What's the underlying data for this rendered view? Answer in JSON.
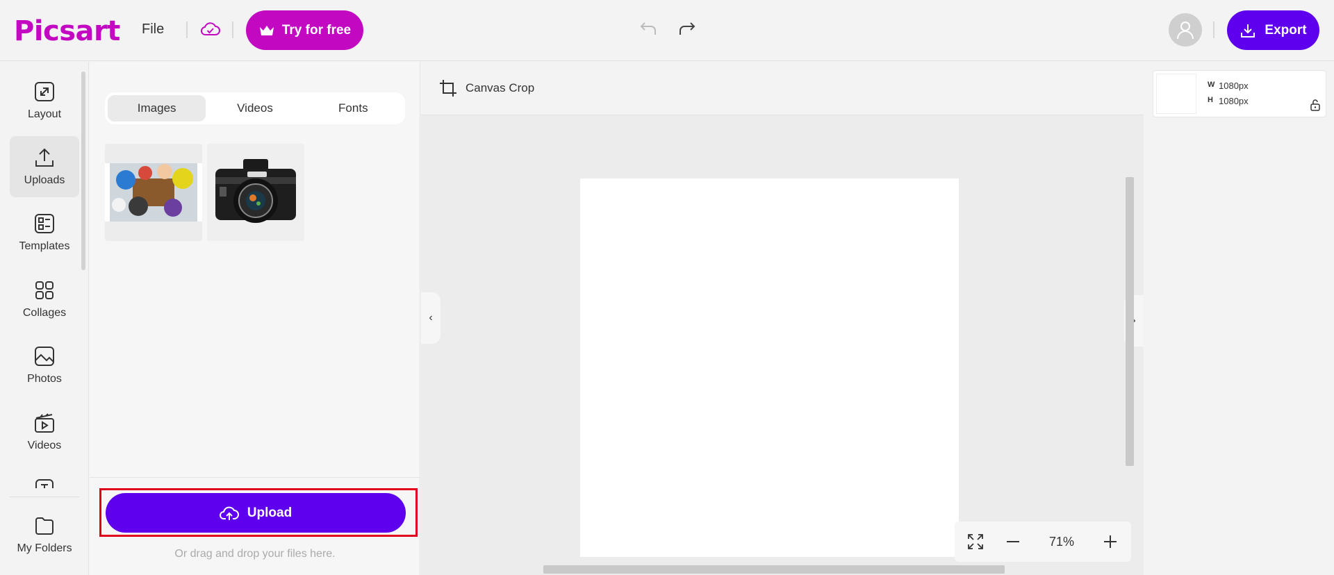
{
  "header": {
    "logo": "Picsart",
    "file_label": "File",
    "try_label": "Try for free",
    "export_label": "Export"
  },
  "colors": {
    "brand_magenta": "#c209c1",
    "primary_purple": "#5e00ee",
    "highlight_red": "#e0001b"
  },
  "nav": {
    "items": [
      {
        "label": "Layout",
        "icon": "layout-icon"
      },
      {
        "label": "Uploads",
        "icon": "upload-icon"
      },
      {
        "label": "Templates",
        "icon": "templates-icon"
      },
      {
        "label": "Collages",
        "icon": "collages-icon"
      },
      {
        "label": "Photos",
        "icon": "photos-icon"
      },
      {
        "label": "Videos",
        "icon": "videos-icon"
      },
      {
        "label": "My Folders",
        "icon": "folder-icon"
      }
    ],
    "active": "Uploads"
  },
  "panel": {
    "tabs": [
      "Images",
      "Videos",
      "Fonts"
    ],
    "active_tab": "Images",
    "upload_label": "Upload",
    "drag_hint": "Or drag and drop your files here."
  },
  "canvas": {
    "crop_label": "Canvas Crop",
    "zoom": "71%"
  },
  "size": {
    "w_label": "W",
    "w_value": "1080px",
    "h_label": "H",
    "h_value": "1080px"
  }
}
